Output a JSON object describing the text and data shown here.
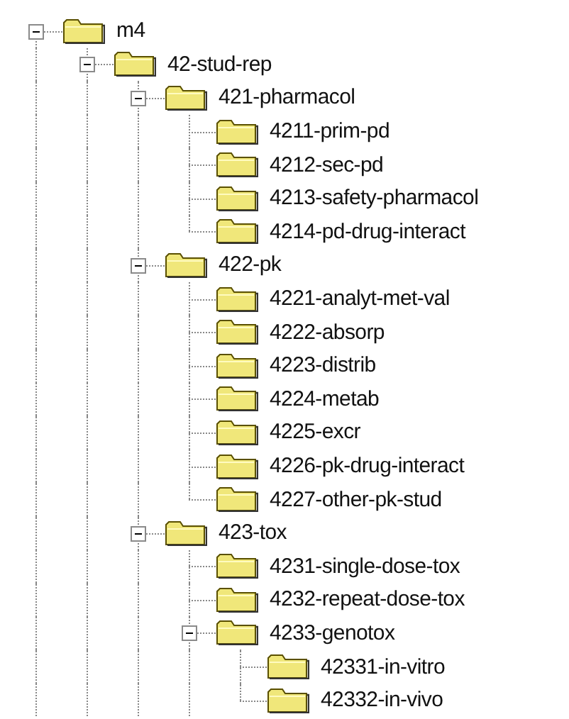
{
  "tree": [
    {
      "label": "m4",
      "expanded": true,
      "more_below": true,
      "children": [
        {
          "label": "42-stud-rep",
          "expanded": true,
          "more_below": true,
          "children": [
            {
              "label": "421-pharmacol",
              "expanded": true,
              "children": [
                {
                  "label": "4211-prim-pd"
                },
                {
                  "label": "4212-sec-pd"
                },
                {
                  "label": "4213-safety-pharmacol"
                },
                {
                  "label": "4214-pd-drug-interact"
                }
              ]
            },
            {
              "label": "422-pk",
              "expanded": true,
              "children": [
                {
                  "label": "4221-analyt-met-val"
                },
                {
                  "label": "4222-absorp"
                },
                {
                  "label": "4223-distrib"
                },
                {
                  "label": "4224-metab"
                },
                {
                  "label": "4225-excr"
                },
                {
                  "label": "4226-pk-drug-interact"
                },
                {
                  "label": "4227-other-pk-stud"
                }
              ]
            },
            {
              "label": "423-tox",
              "expanded": true,
              "more_below": true,
              "children": [
                {
                  "label": "4231-single-dose-tox"
                },
                {
                  "label": "4232-repeat-dose-tox"
                },
                {
                  "label": "4233-genotox",
                  "expanded": true,
                  "more_below": true,
                  "children": [
                    {
                      "label": "42331-in-vitro"
                    },
                    {
                      "label": "42332-in-vivo"
                    }
                  ]
                }
              ]
            }
          ]
        }
      ]
    }
  ]
}
